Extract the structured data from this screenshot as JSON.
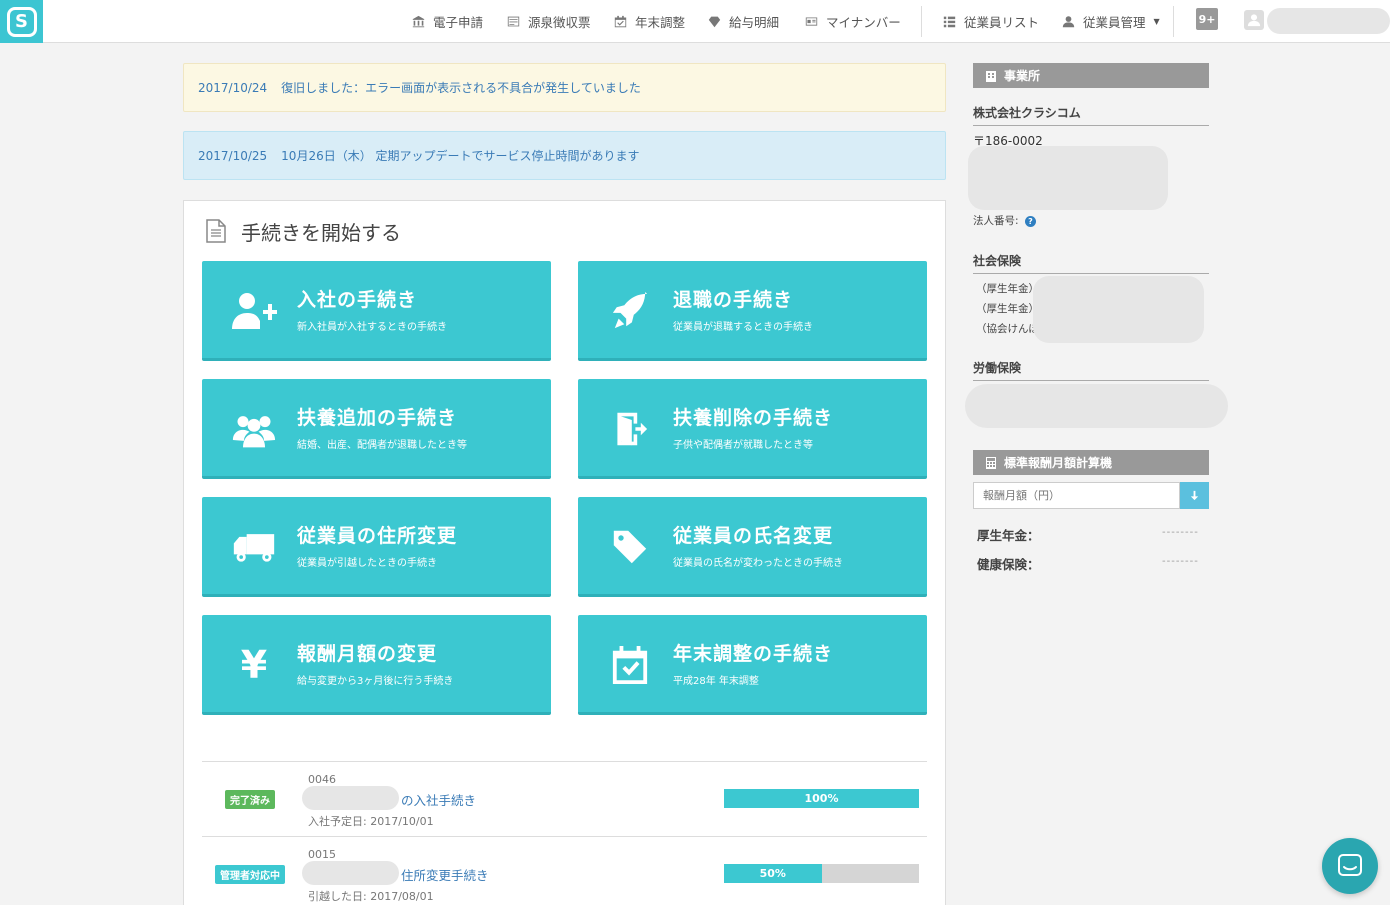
{
  "nav": {
    "items": [
      {
        "label": "電子申請",
        "icon": "bank-icon"
      },
      {
        "label": "源泉徴収票",
        "icon": "receipt-icon"
      },
      {
        "label": "年末調整",
        "icon": "calendar-icon"
      },
      {
        "label": "給与明細",
        "icon": "gem-icon"
      },
      {
        "label": "マイナンバー",
        "icon": "id-card-icon"
      },
      {
        "label": "従業員リスト",
        "icon": "list-icon"
      },
      {
        "label": "従業員管理",
        "icon": "user-icon"
      }
    ],
    "notification_badge": "9+"
  },
  "notices": [
    {
      "date": "2017/10/24",
      "text": "復旧しました：エラー画面が表示される不具合が発生していました"
    },
    {
      "date": "2017/10/25",
      "text": "10月26日（木） 定期アップデートでサービス停止時間があります"
    }
  ],
  "panel": {
    "title": "手続きを開始する",
    "tiles": [
      {
        "title": "入社の手続き",
        "sub": "新入社員が入社するときの手続き",
        "icon": "user-plus-icon"
      },
      {
        "title": "退職の手続き",
        "sub": "従業員が退職するときの手続き",
        "icon": "rocket-icon"
      },
      {
        "title": "扶養追加の手続き",
        "sub": "結婚、出産、配偶者が退職したとき等",
        "icon": "users-icon"
      },
      {
        "title": "扶養削除の手続き",
        "sub": "子供や配偶者が就職したとき等",
        "icon": "exit-door-icon"
      },
      {
        "title": "従業員の住所変更",
        "sub": "従業員が引越したときの手続き",
        "icon": "truck-icon"
      },
      {
        "title": "従業員の氏名変更",
        "sub": "従業員の氏名が変わったときの手続き",
        "icon": "tag-icon"
      },
      {
        "title": "報酬月額の変更",
        "sub": "給与変更から3ヶ月後に行う手続き",
        "icon": "yen-icon"
      },
      {
        "title": "年末調整の手続き",
        "sub": "平成28年 年末調整",
        "icon": "calendar-check-icon"
      }
    ],
    "procedures": [
      {
        "status": "完了済み",
        "status_color": "#5cb85c",
        "id": "0046",
        "name": "の入社手続き",
        "date": "入社予定日: 2017/10/01",
        "progress_label": "100%",
        "progress": 1.0
      },
      {
        "status": "管理者対応中",
        "status_color": "#3cc8d1",
        "id": "0015",
        "name": "住所変更手続き",
        "date": "引越した日: 2017/08/01",
        "progress_label": "50%",
        "progress": 0.5
      }
    ]
  },
  "sidebar": {
    "office": {
      "header": "事業所",
      "company": "株式会社クラシコム",
      "postal": "〒186-0002",
      "corp_number_label": "法人番号:",
      "social_title": "社会保険",
      "social_items": [
        "（厚生年金）",
        "（厚生年金）",
        "（協会けんぽ"
      ],
      "labor_title": "労働保険"
    },
    "calculator": {
      "header": "標準報酬月額計算機",
      "placeholder": "報酬月額（円）",
      "rows": [
        {
          "label": "厚生年金：",
          "value": "--------"
        },
        {
          "label": "健康保険：",
          "value": "--------"
        }
      ]
    }
  },
  "colors": {
    "accent": "#3cc8d1",
    "link": "#3a7bb6"
  }
}
